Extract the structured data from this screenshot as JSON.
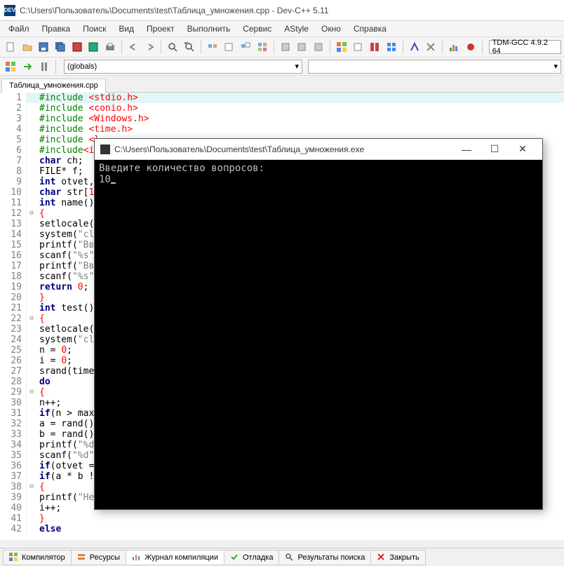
{
  "window": {
    "title": "C:\\Users\\Пользователь\\Documents\\test\\Таблица_умножения.cpp - Dev-C++ 5.11",
    "app_icon_text": "DEV"
  },
  "menu": [
    "Файл",
    "Правка",
    "Поиск",
    "Вид",
    "Проект",
    "Выполнить",
    "Сервис",
    "AStyle",
    "Окно",
    "Справка"
  ],
  "compiler_combo": "TDM-GCC 4.9.2 64",
  "globals": "(globals)",
  "tab": "Таблица_умножения.cpp",
  "code_lines": [
    {
      "n": 1,
      "hl": true,
      "fold": "",
      "html": "<span class='pp'>#include </span><span class='red'>&lt;stdio.h&gt;</span>"
    },
    {
      "n": 2,
      "fold": "",
      "html": "<span class='pp'>#include </span><span class='red'>&lt;conio.h&gt;</span>"
    },
    {
      "n": 3,
      "fold": "",
      "html": "<span class='pp'>#include </span><span class='red'>&lt;Windows.h&gt;</span>"
    },
    {
      "n": 4,
      "fold": "",
      "html": "<span class='pp'>#include </span><span class='red'>&lt;time.h&gt;</span>"
    },
    {
      "n": 5,
      "fold": "",
      "html": "<span class='pp'>#include </span><span class='red'>&lt;l</span>"
    },
    {
      "n": 6,
      "fold": "",
      "html": "<span class='pp'>#include</span><span class='red'>&lt;io</span>"
    },
    {
      "n": 7,
      "fold": "",
      "html": "<span class='kw'>char</span> ch;"
    },
    {
      "n": 8,
      "fold": "",
      "html": "<span class='plain'>FILE* f;</span>"
    },
    {
      "n": 9,
      "fold": "",
      "html": "<span class='kw'>int</span> otvet,"
    },
    {
      "n": 10,
      "fold": "",
      "html": "<span class='kw'>char</span> str[<span class='red'>10</span>"
    },
    {
      "n": 11,
      "fold": "",
      "html": "<span class='kw'>int</span> name()"
    },
    {
      "n": 12,
      "fold": "⊟",
      "html": "<span class='red'>{</span>"
    },
    {
      "n": 13,
      "fold": "",
      "html": "setlocale(<span class='red'>L</span>"
    },
    {
      "n": 14,
      "fold": "",
      "html": "system(<span class='str'>\"cls</span>"
    },
    {
      "n": 15,
      "fold": "",
      "html": "printf(<span class='str'>\"Вв</span>"
    },
    {
      "n": 16,
      "fold": "",
      "html": "scanf(<span class='str'>\"%s\"</span>,"
    },
    {
      "n": 17,
      "fold": "",
      "html": "printf(<span class='str'>\"Вв</span>"
    },
    {
      "n": 18,
      "fold": "",
      "html": "scanf(<span class='str'>\"%s\"</span>,"
    },
    {
      "n": 19,
      "fold": "",
      "html": "<span class='kw'>return</span> <span class='red'>0</span>;"
    },
    {
      "n": 20,
      "fold": "",
      "html": "<span class='red'>}</span>"
    },
    {
      "n": 21,
      "fold": "",
      "html": "<span class='kw'>int</span> test()"
    },
    {
      "n": 22,
      "fold": "⊟",
      "html": "<span class='red'>{</span>"
    },
    {
      "n": 23,
      "fold": "",
      "html": "setlocale(<span class='red'>L</span>"
    },
    {
      "n": 24,
      "fold": "",
      "html": "system(<span class='str'>\"cls</span>"
    },
    {
      "n": 25,
      "fold": "",
      "html": "n = <span class='red'>0</span>;"
    },
    {
      "n": 26,
      "fold": "",
      "html": "i = <span class='red'>0</span>;"
    },
    {
      "n": 27,
      "fold": "",
      "html": "srand(time("
    },
    {
      "n": 28,
      "fold": "",
      "html": "<span class='kw'>do</span>"
    },
    {
      "n": 29,
      "fold": "⊟",
      "html": "<span class='red'>{</span>"
    },
    {
      "n": 30,
      "fold": "",
      "html": "n++;"
    },
    {
      "n": 31,
      "fold": "",
      "html": "<span class='kw'>if</span>(n &gt; maxn"
    },
    {
      "n": 32,
      "fold": "",
      "html": "a = rand()%"
    },
    {
      "n": 33,
      "fold": "",
      "html": "b = rand()%"
    },
    {
      "n": 34,
      "fold": "",
      "html": "printf(<span class='str'>\"%d</span>"
    },
    {
      "n": 35,
      "fold": "",
      "html": "scanf(<span class='str'>\"%d\"</span>,"
    },
    {
      "n": 36,
      "fold": "",
      "html": "<span class='kw'>if</span>(otvet =="
    },
    {
      "n": 37,
      "fold": "",
      "html": "<span class='kw'>if</span>(a * b !="
    },
    {
      "n": 38,
      "fold": "⊟",
      "html": "<span class='red'>{</span>"
    },
    {
      "n": 39,
      "fold": "",
      "html": "printf(<span class='str'>\"Не правильно. Правильный ответ %d!\\n\"</span>, (a * b));"
    },
    {
      "n": 40,
      "fold": "",
      "html": "i++;"
    },
    {
      "n": 41,
      "fold": "",
      "html": "<span class='red'>}</span>"
    },
    {
      "n": 42,
      "fold": "",
      "html": "<span class='kw'>else</span>"
    }
  ],
  "bottom_tabs": [
    {
      "icon": "grid",
      "label": "Компилятор"
    },
    {
      "icon": "stack",
      "label": "Ресурсы"
    },
    {
      "icon": "log",
      "label": "Журнал компиляции",
      "active": true
    },
    {
      "icon": "check",
      "label": "Отладка"
    },
    {
      "icon": "search",
      "label": "Результаты поиска"
    },
    {
      "icon": "close",
      "label": "Закрыть"
    }
  ],
  "console": {
    "title": "C:\\Users\\Пользователь\\Documents\\test\\Таблица_умножения.exe",
    "line1": "Введите количество вопросов:",
    "line2": "10"
  }
}
